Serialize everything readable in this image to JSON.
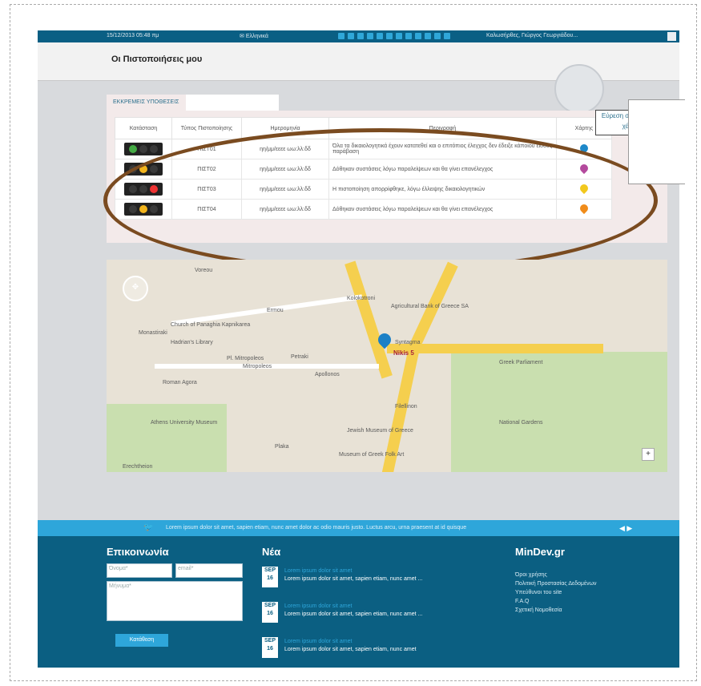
{
  "topbar": {
    "datetime": "15/12/2013 05:48 πμ",
    "language": "Ελληνικά",
    "user": "Καλωσήρθες, Γιώργος Γεωργιάδου..."
  },
  "header": {
    "title": "Οι Πιστοποιήσεις μου"
  },
  "tabs": [
    {
      "label": "ΕΚΚΡΕΜΕΙΣ ΥΠΟΘΕΣΕΙΣ"
    },
    {
      "label": ""
    }
  ],
  "table": {
    "headers": [
      "Κατάσταση",
      "Τύπος Πιστοποίησης",
      "Ημερομηνία",
      "Περιγραφή",
      "Χάρτης"
    ],
    "rows": [
      {
        "type": "ΠΙΣΤ01",
        "date": "ηη/μμ/εεεε ωω:λλ:δδ",
        "desc": "Όλα τα δικαιολογητικά έχουν κατατεθεί και ο επιτόπιος έλεγχος δεν έδειξε κάποιου είδους παράβαση",
        "lights": [
          "#4a4",
          "#3a3a3a",
          "#3a3a3a"
        ],
        "pin": "#1e88c9"
      },
      {
        "type": "ΠΙΣΤ02",
        "date": "ηη/μμ/εεεε ωω:λλ:δδ",
        "desc": "Δόθηκαν συστάσεις λόγω παραλείψεων και θα γίνει επανέλεγχος",
        "lights": [
          "#3a3a3a",
          "#f2b41c",
          "#3a3a3a"
        ],
        "pin": "#b44a9d"
      },
      {
        "type": "ΠΙΣΤ03",
        "date": "ηη/μμ/εεεε ωω:λλ:δδ",
        "desc": "Η πιστοποίηση απορρίφθηκε, λόγω έλλειψης δικαιολογητικών",
        "lights": [
          "#3a3a3a",
          "#3a3a3a",
          "#e33"
        ],
        "pin": "#f2c81e"
      },
      {
        "type": "ΠΙΣΤ04",
        "date": "ηη/μμ/εεεε ωω:λλ:δδ",
        "desc": "Δόθηκαν συστάσεις λόγω παραλείψεων και θα γίνει επανέλεγχος",
        "lights": [
          "#3a3a3a",
          "#f2b41c",
          "#3a3a3a"
        ],
        "pin": "#f08c1a"
      }
    ]
  },
  "callout": {
    "text": "Εύρεση σημείου στο χάρτη"
  },
  "map": {
    "labels": [
      "Voreou",
      "Church of Panaghia Kapnikarea",
      "Hadrian's Library",
      "Pl. Mitropoleos",
      "Roman Agora",
      "Athens University Museum",
      "Kolokotroni",
      "Agricultural Bank of Greece SA",
      "Greek Parliament",
      "National Gardens",
      "Jewish Museum of Greece",
      "Museum of Greek Folk Art",
      "Apollonos",
      "Erechtheion",
      "Filellinon",
      "Petraki",
      "Monastiraki",
      "Syntagma",
      "Ermou",
      "Mitropoleos",
      "Plaka"
    ],
    "pin_label": "Nikis 5"
  },
  "ticker": {
    "text": "Lorem ipsum dolor sit amet, sapien etiam, nunc amet dolor ac odio mauris justo. Luctus arcu, urna praesent at id quisque"
  },
  "footer": {
    "contact_title": "Επικοινωνία",
    "name_placeholder": "Όνομα*",
    "email_placeholder": "email*",
    "message_placeholder": "Μήνυμα*",
    "submit_label": "Κατάθεση",
    "news_title": "Νέα",
    "news": [
      {
        "month": "SEP",
        "day": "16",
        "title": "Lorem ipsum dolor sit amet",
        "text": "Lorem ipsum dolor sit amet, sapien etiam, nunc amet ..."
      },
      {
        "month": "SEP",
        "day": "16",
        "title": "Lorem ipsum dolor sit amet",
        "text": "Lorem ipsum dolor sit amet, sapien etiam, nunc amet ..."
      },
      {
        "month": "SEP",
        "day": "16",
        "title": "Lorem ipsum dolor sit amet",
        "text": "Lorem ipsum dolor sit amet, sapien etiam, nunc amet"
      }
    ],
    "site_title": "MinDev.gr",
    "links": [
      "Όροι χρήσης",
      "Πολιτική Προστασίας Δεδομένων",
      "Υπεύθυνοι του site",
      "F.A.Q",
      "Σχετική Νομοθεσία"
    ]
  }
}
